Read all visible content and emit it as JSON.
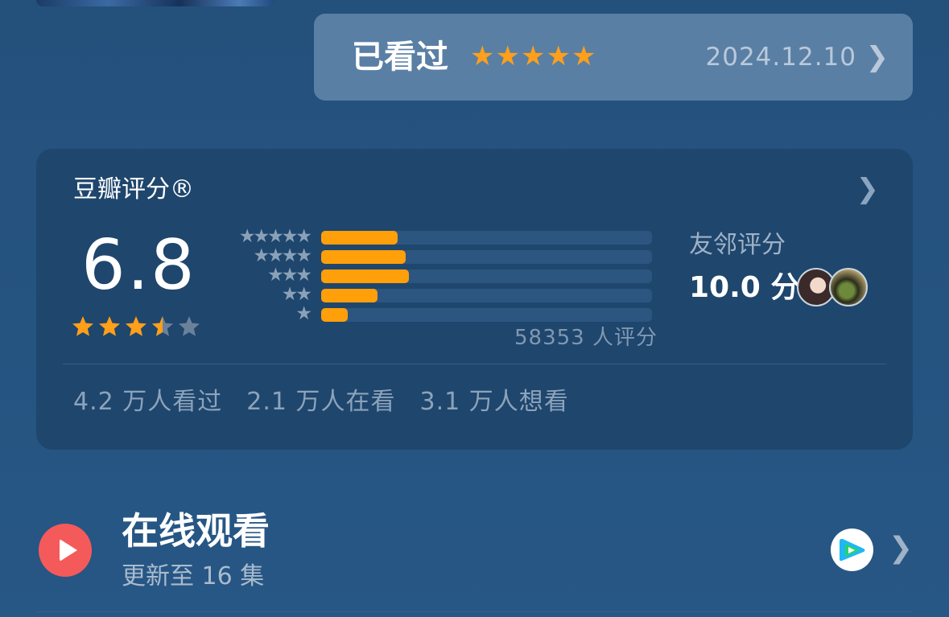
{
  "watched": {
    "label": "已看过",
    "user_rating": 5,
    "date": "2024.12.10",
    "chevron": "chevron-right-icon"
  },
  "douban": {
    "title": "豆瓣评分®",
    "score": "6.8",
    "score_stars": 3.5,
    "distribution": [
      {
        "stars": 5,
        "stars_text": "★★★★★",
        "fraction": 0.23
      },
      {
        "stars": 4,
        "stars_text": "★★★★",
        "fraction": 0.255
      },
      {
        "stars": 3,
        "stars_text": "★★★",
        "fraction": 0.265
      },
      {
        "stars": 2,
        "stars_text": "★★",
        "fraction": 0.17
      },
      {
        "stars": 1,
        "stars_text": "★",
        "fraction": 0.08
      }
    ],
    "count": "58353 人评分",
    "friend_label": "友邻评分",
    "friend_score": "10.0 分",
    "stats": [
      "4.2 万人看过",
      "2.1 万人在看",
      "3.1 万人想看"
    ]
  },
  "online": {
    "title": "在线观看",
    "subtitle": "更新至 16 集",
    "play_icon": "play-icon",
    "app_icon": "video-app-icon"
  },
  "colors": {
    "accent_star": "#ff9f1a",
    "bar_fill": "#ff9f0a",
    "play_red": "#f55a5a",
    "background": "#245381"
  }
}
